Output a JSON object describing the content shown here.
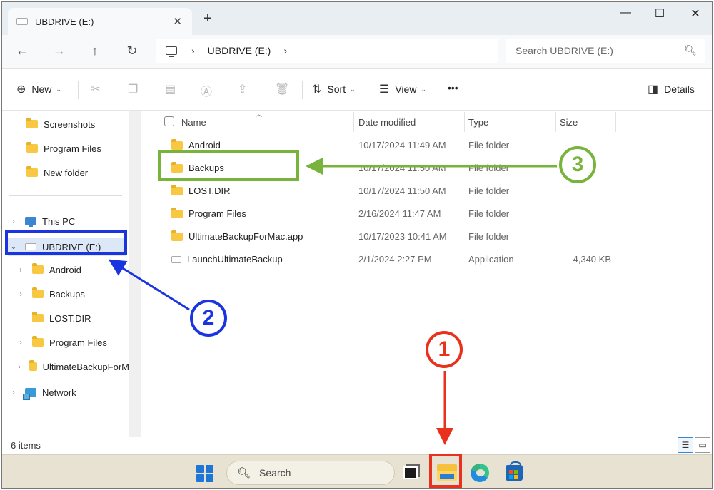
{
  "window": {
    "tab_title": "UBDRIVE (E:)",
    "tab_close": "✕",
    "new_tab": "+",
    "minimize": "—",
    "maximize": "☐",
    "close": "✕"
  },
  "nav": {
    "back": "←",
    "forward": "→",
    "up": "↑",
    "refresh": "↻",
    "breadcrumb_sep": "›",
    "breadcrumb": "UBDRIVE (E:)",
    "breadcrumb_more": "›",
    "search_placeholder": "Search UBDRIVE (E:)"
  },
  "toolbar": {
    "new_label": "New",
    "sort_label": "Sort",
    "view_label": "View",
    "more_label": "•••",
    "details_label": "Details"
  },
  "sidebar": {
    "quick": [
      {
        "label": "Screenshots"
      },
      {
        "label": "Program Files"
      },
      {
        "label": "New folder"
      }
    ],
    "this_pc": "This PC",
    "drive": "UBDRIVE (E:)",
    "drive_children": [
      {
        "label": "Android",
        "expandable": true
      },
      {
        "label": "Backups",
        "expandable": true
      },
      {
        "label": "LOST.DIR",
        "expandable": false
      },
      {
        "label": "Program Files",
        "expandable": true
      },
      {
        "label": "UltimateBackupForM",
        "expandable": true
      }
    ],
    "network": "Network"
  },
  "columns": {
    "name": "Name",
    "date": "Date modified",
    "type": "Type",
    "size": "Size"
  },
  "files": [
    {
      "name": "Android",
      "date": "10/17/2024 11:49 AM",
      "type": "File folder",
      "size": "",
      "kind": "folder"
    },
    {
      "name": "Backups",
      "date": "10/17/2024 11:50 AM",
      "type": "File folder",
      "size": "",
      "kind": "folder"
    },
    {
      "name": "LOST.DIR",
      "date": "10/17/2024 11:50 AM",
      "type": "File folder",
      "size": "",
      "kind": "folder"
    },
    {
      "name": "Program Files",
      "date": "2/16/2024 11:47 AM",
      "type": "File folder",
      "size": "",
      "kind": "folder"
    },
    {
      "name": "UltimateBackupForMac.app",
      "date": "10/17/2023 10:41 AM",
      "type": "File folder",
      "size": "",
      "kind": "folder"
    },
    {
      "name": "LaunchUltimateBackup",
      "date": "2/1/2024 2:27 PM",
      "type": "Application",
      "size": "4,340 KB",
      "kind": "app"
    }
  ],
  "status": {
    "items": "6 items"
  },
  "taskbar": {
    "search_label": "Search"
  },
  "annotations": {
    "step1": "1",
    "step2": "2",
    "step3": "3",
    "color_step1": "#e8321e",
    "color_step2": "#1a35e0",
    "color_step3": "#78b43c"
  }
}
